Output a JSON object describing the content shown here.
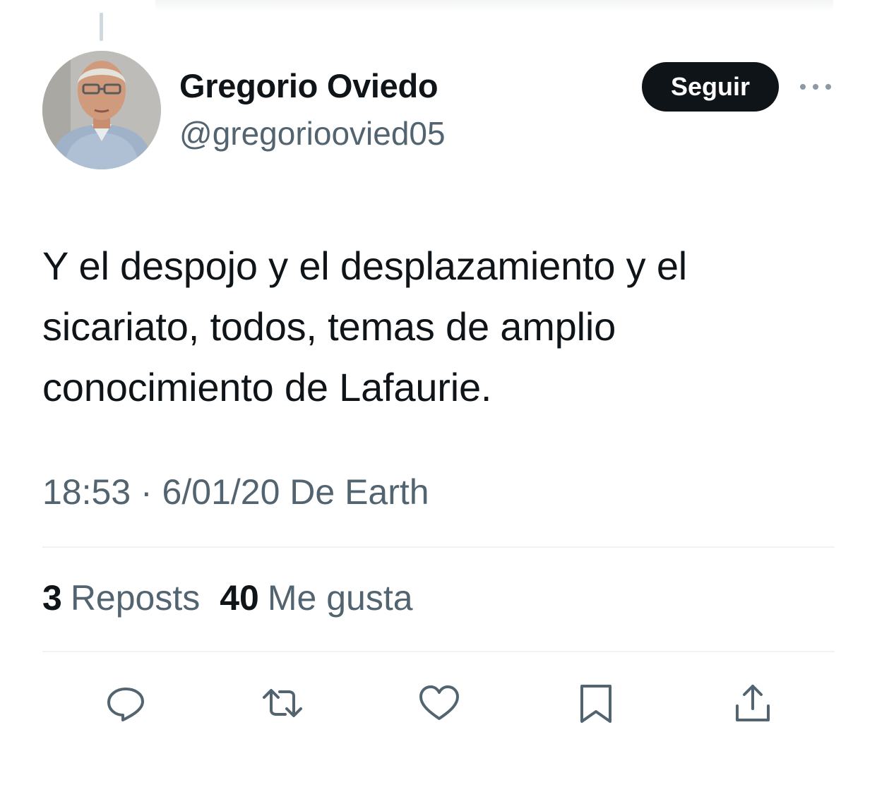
{
  "author": {
    "display_name": "Gregorio Oviedo",
    "handle": "@gregorioovied05"
  },
  "follow_button": {
    "label": "Seguir"
  },
  "tweet": {
    "text": "Y el despojo y el desplazamiento y el sicariato, todos, temas de amplio conocimiento de Lafaurie.",
    "meta": "18:53 · 6/01/20 De Earth"
  },
  "stats": {
    "reposts_count": "3",
    "reposts_label": "Reposts",
    "likes_count": "40",
    "likes_label": "Me gusta"
  },
  "actions": [
    "reply-icon",
    "repost-icon",
    "like-icon",
    "bookmark-icon",
    "share-icon"
  ],
  "colors": {
    "text_primary": "#0f1419",
    "text_secondary": "#536471",
    "divider": "#eff3f4",
    "button_bg": "#0f1419"
  }
}
